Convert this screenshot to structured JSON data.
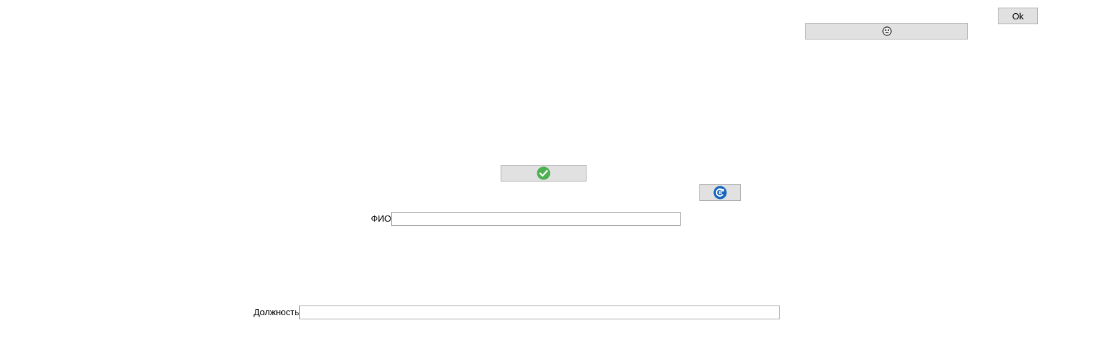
{
  "buttons": {
    "ok_label": "Ok",
    "face_icon": "smiley-face-icon",
    "check_icon": "green-check-icon",
    "refresh_icon": "blue-refresh-icon"
  },
  "form": {
    "fio": {
      "label": "ФИО",
      "value": "",
      "placeholder": ""
    },
    "position": {
      "label": "Должность",
      "value": "",
      "placeholder": ""
    }
  },
  "colors": {
    "button_bg": "#e1e1e1",
    "button_border": "#adadad",
    "field_border": "#aaaaaa",
    "check_green": "#4caf50",
    "refresh_blue": "#1565c0"
  }
}
